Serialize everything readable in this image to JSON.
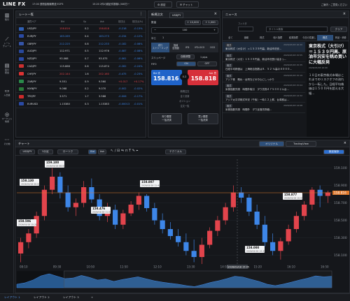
{
  "topbar": {
    "logo": "LINE FX",
    "news_items": [
      "17:00 週間金融機関連 ECP3",
      "15:20 2件の認証件数機1,546万ー"
    ],
    "btn_settings": "設定",
    "btn_chat": "チャット",
    "right_text": "ご案内・ご意見ください"
  },
  "sidebar": {
    "items": [
      {
        "label": "取引",
        "icon": "chart-bar-icon"
      },
      {
        "label": "レート\nチャート",
        "icon": "line-chart-icon"
      },
      {
        "label": "取引\n照会",
        "icon": "document-icon"
      },
      {
        "label": "入出金",
        "icon": "wallet-icon"
      },
      {
        "label": "マーケット\n情報",
        "icon": "globe-icon"
      },
      {
        "label": "その他",
        "icon": "menu-icon"
      }
    ]
  },
  "rates": {
    "title": "レート一覧",
    "headers": [
      "通貨ペア",
      "Bid",
      "Sp",
      "Ask",
      "前日比",
      "前日比(%)"
    ],
    "rows": [
      {
        "pair": "USDJPY",
        "bid": "158.816",
        "sp": "0.2",
        "ask": "158.818",
        "chg": "-0.218",
        "pct": "-0.13%",
        "flag": "#2f5fb3",
        "dir": "red"
      },
      {
        "pair": "EURJPY",
        "bid": "183.269",
        "sp": "0.4",
        "ask": "183.273",
        "chg": "-0.234",
        "pct": "-0.12%",
        "flag": "#2a4aa5",
        "dir": "blue"
      },
      {
        "pair": "GBPJPY",
        "bid": "212.225",
        "sp": "0.8",
        "ask": "212.233",
        "chg": "-0.182",
        "pct": "-0.08%",
        "flag": "#3454a8",
        "dir": "blue"
      },
      {
        "pair": "AUDJPY",
        "bid": "112.971",
        "sp": "0.5",
        "ask": "112.976",
        "chg": "-0.087",
        "pct": "-0.08%",
        "flag": "#28489b",
        "dir": "wht"
      },
      {
        "pair": "NZDJPY",
        "bid": "93.068",
        "sp": "0.7",
        "ask": "93.075",
        "chg": "-0.061",
        "pct": "-0.06%",
        "flag": "#2a4aa5",
        "dir": "wht"
      },
      {
        "pair": "CADJPY",
        "bid": "115.868",
        "sp": "0.6",
        "ask": "115.874",
        "chg": "-0.282",
        "pct": "-0.24%",
        "flag": "#cc3030",
        "dir": "wht"
      },
      {
        "pair": "CHFJPY",
        "bid": "202.144",
        "sp": "1.6",
        "ask": "202.160",
        "chg": "-0.475",
        "pct": "-0.23%",
        "flag": "#d33",
        "dir": "red"
      },
      {
        "pair": "ZARJPY",
        "bid": "9.551",
        "sp": "0.9",
        "ask": "9.560",
        "chg": "+0.017",
        "pct": "+0.17%",
        "flag": "#2a8a4a",
        "dir": "wht"
      },
      {
        "pair": "MXNJPY",
        "bid": "9.068",
        "sp": "0.2",
        "ask": "9.070",
        "chg": "-0.002",
        "pct": "-0.02%",
        "flag": "#2a7a3a",
        "dir": "wht"
      },
      {
        "pair": "TRYJPY",
        "bid": "3.571",
        "sp": "1.7",
        "ask": "3.588",
        "chg": "-0.006",
        "pct": "-0.17%",
        "flag": "#cc2a2a",
        "dir": "wht"
      },
      {
        "pair": "EURUSD",
        "bid": "1.15380",
        "sp": "0.3",
        "ask": "1.15383",
        "chg": "-0.00013",
        "pct": "-0.01%",
        "flag": "#2a4aa5",
        "dir": "wht"
      }
    ]
  },
  "order": {
    "title": "新規注文",
    "pair": "USDJPY",
    "qty_label": "数量",
    "qty_btn1": "+ 10,000",
    "qty_btn2": "+ 1,000",
    "qty_value": "100",
    "unit_label": "単位",
    "unit_value": "1",
    "mode_tabs": [
      "成行\nストリーミング",
      "指値\n逆指値",
      "IFD",
      "IFD-OCO",
      "OCO"
    ],
    "slip_label": "スリッページ",
    "slip_mode": "自動調整",
    "slip_value": "1 pips",
    "fifo_label": "FIFO",
    "fifo_on": "ON",
    "fifo_off": "OFF",
    "sell_label": "Bid 売",
    "sell_price": "158.816",
    "spread": "0.2",
    "buy_label": "Ask 買",
    "buy_price": "158.818",
    "links": [
      "新規注文",
      "全て決済",
      "ポジション",
      "注文一覧"
    ],
    "close_sell": "売り履歴\n一括決済",
    "close_buy": "買い履歴\n一括決済"
  },
  "news": {
    "title": "ニュース",
    "filter_label": "フィルタ",
    "keyword_ph": "タイトル検索",
    "clear": "クリア",
    "tabs": [
      "全て",
      "速報",
      "株式",
      "個人指標",
      "経済指標",
      "今日の見通し",
      "株式",
      "商品・債券"
    ],
    "items": [
      {
        "tag": "株式",
        "time": "2026/03/18 16:40",
        "text": "東京株式（大引け）＝１５３９円高、新油市況安..."
      },
      {
        "tag": "株式",
        "time": "2026/03/18 15:55",
        "text": "東京株式（大引）１５３９円高、新油市況受け高まっ..."
      },
      {
        "tag": "株式",
        "time": "2026/03/18 15:35",
        "text": "日経平均株価は　上海総合指数は８．５２ %高の４０００..."
      },
      {
        "tag": "株式",
        "time": "2026/03/18 15:19",
        "text": "アジア株　概ね・台湾などの中心にしっかり"
      },
      {
        "tag": "株式",
        "time": "2026/03/18 15:04",
        "text": "米株指数先物　時間外取引　ダウ先物４７５００ドル台..."
      },
      {
        "tag": "株式",
        "time": "2026/03/18 14:32",
        "text": "アジア太平洋株式市況（午後）一時１２上昇、台湾株は..."
      },
      {
        "tag": "株式",
        "time": "2026/03/18 14:08",
        "text": "米株指数先物　時間外　ダウ反落先物価..."
      }
    ],
    "headline": "東京株式（大引け）＝１５３９円高、原油市況安を眺め買いに大幅反発",
    "headline_time": "2026/03/18 16:40",
    "body": "１８日の東京株式市場はこれまでのリスクオフの流れから一転した。日経平均株価は１５００円を超える大幅..."
  },
  "chart": {
    "title": "チャート",
    "pair": "USDJPY",
    "interval": "5分足",
    "style": "ローソク",
    "bid": "Bid",
    "ask": "Ask",
    "indicator": "テクニカル",
    "tab_original": "オリジナル",
    "tab_tv": "TradingView",
    "save": "設定保存",
    "current_price": "158.816",
    "tooltips": [
      {
        "price": "158.130",
        "time": "2026/03/18 08:00"
      },
      {
        "price": "159.100",
        "time": "2026/03/18 08:55"
      },
      {
        "price": "158.807",
        "time": "2026/03/18 11:40"
      },
      {
        "price": "158.476",
        "time": "2026/03/18 11:00"
      },
      {
        "price": "158.000",
        "time": "2026/03/18 14:35"
      },
      {
        "price": "158.877",
        "time": "2026/03/18 16:55"
      },
      {
        "price": "158.506",
        "time": "2026/03/18 15:20"
      }
    ],
    "crosshair_time": "2026/03/18 15:05",
    "x_labels": [
      "08:10",
      "09:30",
      "10:50",
      "11:50",
      "12:10",
      "13:30",
      "14:50",
      "15:20",
      "16:10",
      "16:50"
    ],
    "y_labels": [
      "159.100",
      "158.900",
      "158.700",
      "158.500",
      "158.300",
      "158.100"
    ]
  },
  "chart_data": {
    "type": "candlestick",
    "ohlc": [
      [
        158.12,
        158.3,
        158.02,
        158.25
      ],
      [
        158.25,
        158.4,
        158.18,
        158.35
      ],
      [
        158.35,
        158.6,
        158.3,
        158.55
      ],
      [
        158.55,
        158.9,
        158.5,
        158.85
      ],
      [
        158.85,
        159.1,
        158.8,
        159.0
      ],
      [
        159.0,
        159.05,
        158.75,
        158.82
      ],
      [
        158.82,
        158.9,
        158.6,
        158.65
      ],
      [
        158.65,
        158.75,
        158.55,
        158.7
      ],
      [
        158.7,
        158.95,
        158.65,
        158.88
      ],
      [
        158.88,
        158.98,
        158.7,
        158.74
      ],
      [
        158.74,
        158.8,
        158.5,
        158.55
      ],
      [
        158.55,
        158.7,
        158.48,
        158.62
      ],
      [
        158.62,
        158.68,
        158.4,
        158.45
      ],
      [
        158.45,
        158.62,
        158.4,
        158.58
      ],
      [
        158.58,
        158.72,
        158.55,
        158.68
      ],
      [
        158.68,
        158.82,
        158.62,
        158.78
      ],
      [
        158.78,
        158.8,
        158.6,
        158.64
      ],
      [
        158.64,
        158.7,
        158.45,
        158.5
      ],
      [
        158.5,
        158.58,
        158.35,
        158.4
      ],
      [
        158.4,
        158.48,
        158.28,
        158.32
      ],
      [
        158.32,
        158.4,
        158.2,
        158.25
      ],
      [
        158.25,
        158.35,
        158.1,
        158.15
      ],
      [
        158.15,
        158.28,
        158.02,
        158.08
      ],
      [
        158.08,
        158.3,
        158.0,
        158.22
      ],
      [
        158.22,
        158.42,
        158.18,
        158.38
      ],
      [
        158.38,
        158.55,
        158.32,
        158.5
      ],
      [
        158.5,
        158.7,
        158.45,
        158.65
      ],
      [
        158.65,
        158.9,
        158.6,
        158.82
      ],
      [
        158.82,
        158.88,
        158.7,
        158.76
      ],
      [
        158.76,
        158.8,
        158.55,
        158.6
      ],
      [
        158.6,
        158.68,
        158.4,
        158.45
      ],
      [
        158.45,
        158.55,
        158.2,
        158.25
      ],
      [
        158.25,
        158.35,
        158.1,
        158.15
      ],
      [
        158.15,
        158.3,
        158.05,
        158.26
      ],
      [
        158.26,
        158.45,
        158.22,
        158.4
      ],
      [
        158.4,
        158.6,
        158.36,
        158.55
      ],
      [
        158.55,
        158.72,
        158.5,
        158.68
      ],
      [
        158.68,
        158.88,
        158.62,
        158.85
      ],
      [
        158.85,
        158.9,
        158.65,
        158.78
      ],
      [
        158.78,
        158.84,
        158.7,
        158.82
      ]
    ],
    "ylim": [
      158.0,
      159.2
    ],
    "ylabel": "",
    "xlabel": ""
  }
}
